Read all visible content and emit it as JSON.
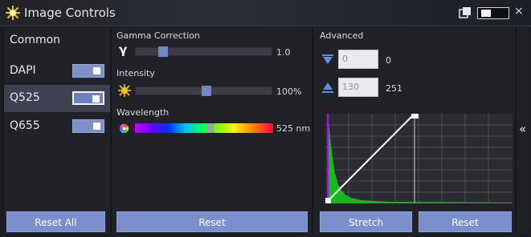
{
  "window": {
    "title": "Image Controls",
    "close_symbol": "×"
  },
  "channels": {
    "header": "Common",
    "items": [
      {
        "label": "DAPI",
        "selected": false,
        "enabled": true
      },
      {
        "label": "Q525",
        "selected": true,
        "enabled": true
      },
      {
        "label": "Q655",
        "selected": false,
        "enabled": true
      }
    ],
    "reset_all_label": "Reset All"
  },
  "gamma": {
    "label": "Gamma Correction",
    "symbol": "γ",
    "value_text": "1.0",
    "fraction": 0.18
  },
  "intensity": {
    "label": "Intensity",
    "value_text": "100%",
    "fraction": 0.52
  },
  "wavelength": {
    "label": "Wavelength",
    "value_text": "525 nm",
    "fraction": 0.55
  },
  "mid_reset_label": "Reset",
  "advanced": {
    "label": "Advanced",
    "black_input_value": "0",
    "black_readout": "0",
    "white_input_value": "130",
    "white_readout": "251",
    "stretch_label": "Stretch",
    "reset_label": "Reset"
  },
  "rail": {
    "expand_symbol": "«"
  },
  "colors": {
    "accent": "#7b8fcc",
    "panel": "#202227",
    "histogram": "#18b81c",
    "selected_row": "#3e4150"
  }
}
